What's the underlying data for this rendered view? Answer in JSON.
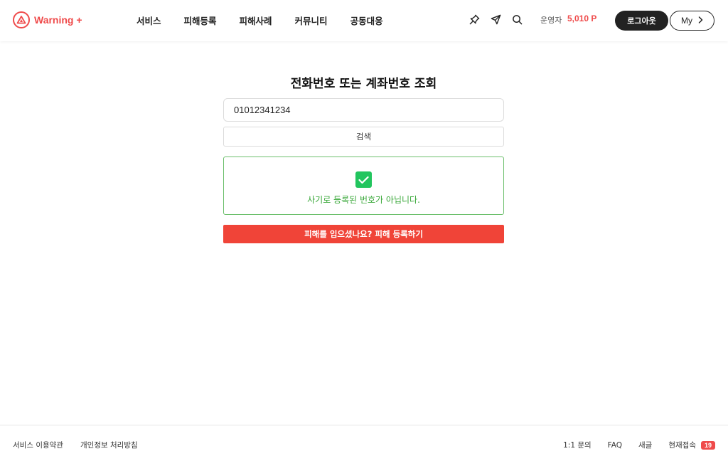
{
  "header": {
    "logo_text": "Warning +",
    "nav": [
      "서비스",
      "피해등록",
      "피해사례",
      "커뮤니티",
      "공동대응"
    ],
    "icons": [
      "pin-icon",
      "send-icon",
      "search-icon"
    ],
    "operator_label": "운영자",
    "points": "5,010 P",
    "logout_label": "로그아웃",
    "my_label": "My"
  },
  "main": {
    "title": "전화번호 또는 계좌번호 조회",
    "search_value": "01012341234",
    "search_button": "검색",
    "result_text": "사기로 등록된 번호가 아닙니다.",
    "report_button": "피해를 입으셨나요? 피해 등록하기"
  },
  "footer": {
    "left_links": [
      "서비스 이용약관",
      "개인정보 처리방침"
    ],
    "right_links": [
      "1:1 문의",
      "FAQ",
      "새글"
    ],
    "online_label": "현재접속",
    "online_count": "19"
  },
  "colors": {
    "brand": "#ef4b4b",
    "success": "#22c55e",
    "report": "#f04438",
    "dark": "#222222"
  }
}
